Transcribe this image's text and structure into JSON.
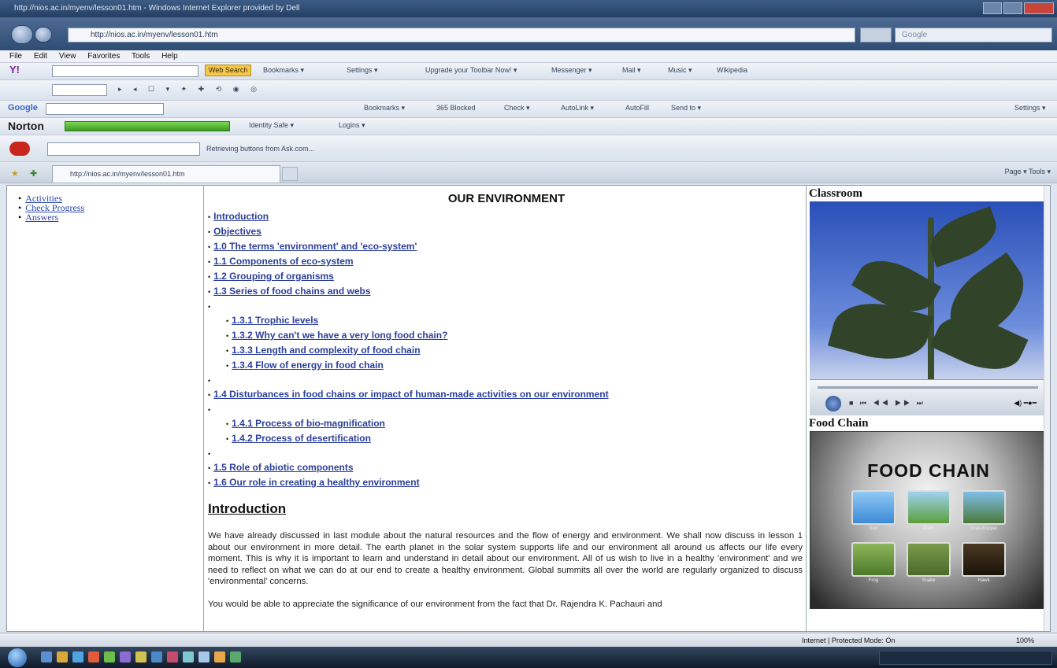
{
  "browser": {
    "title": "http://nios.ac.in/myenv/lesson01.htm - Windows Internet Explorer provided by Dell",
    "url": "http://nios.ac.in/myenv/lesson01.htm",
    "search_placeholder": "Google",
    "menu": [
      "File",
      "Edit",
      "View",
      "Favorites",
      "Tools",
      "Help"
    ],
    "tab_title": "http://nios.ac.in/myenv/lesson01.htm",
    "command_bar": "Page ▾   Tools ▾"
  },
  "toolbars": {
    "yahoo": {
      "web_search": "Web Search",
      "items": [
        "Bookmarks ▾",
        "Settings ▾",
        "Upgrade your Toolbar Now! ▾",
        "Messenger ▾",
        "Mail ▾",
        "Music ▾",
        "Wikipedia"
      ]
    },
    "google": {
      "logo": "Google",
      "items": [
        "Bookmarks ▾",
        "365 Blocked",
        "Check ▾",
        "AutoLink ▾",
        "AutoFill",
        "Send to ▾"
      ],
      "settings": "Settings ▾"
    },
    "norton": {
      "logo": "Norton",
      "items": [
        "Identity Safe ▾",
        "Logins ▾"
      ]
    },
    "ask": {
      "status": "Retrieving buttons from Ask.com..."
    }
  },
  "sidebar_left": {
    "links": [
      "Activities",
      "Check Progress",
      "Answers"
    ]
  },
  "main": {
    "title": "OUR ENVIRONMENT",
    "toc": [
      {
        "label": "Introduction",
        "level": 0
      },
      {
        "label": "Objectives",
        "level": 0
      },
      {
        "label": "1.0 The terms 'environment' and 'eco-system'",
        "level": 0
      },
      {
        "label": "1.1 Components of eco-system",
        "level": 0
      },
      {
        "label": "1.2 Grouping of organisms",
        "level": 0
      },
      {
        "label": "1.3 Series of food chains and webs",
        "level": 0
      },
      {
        "label": "1.3.1 Trophic levels",
        "level": 1
      },
      {
        "label": "1.3.2 Why can't we have a very long food chain?",
        "level": 1
      },
      {
        "label": "1.3.3 Length and complexity of food chain",
        "level": 1
      },
      {
        "label": "1.3.4 Flow of energy in food chain",
        "level": 1
      },
      {
        "label": "1.4 Disturbances in food chains or impact of human-made activities on our environment",
        "level": 0
      },
      {
        "label": "1.4.1 Process of bio-magnification",
        "level": 1
      },
      {
        "label": "1.4.2 Process of desertification",
        "level": 1
      },
      {
        "label": "1.5 Role of abiotic components",
        "level": 0
      },
      {
        "label": "1.6 Our role in creating a healthy environment",
        "level": 0
      }
    ],
    "section_heading": "Introduction",
    "paragraph_1": "We have already discussed in last module about the natural resources and the flow of energy and environment. We shall now discuss in lesson 1 about our environment in more detail. The earth planet in the solar system supports life and our environment all around us affects our life every moment. This is why it is important to learn and understand in detail about our environment. All of us wish to live in a healthy 'environment' and we need to reflect on what we can do at our end to create a healthy environment. Global summits all over the world are regularly organized to discuss 'environmental' concerns.",
    "paragraph_2": "You would be able to appreciate the significance of our environment from the fact that Dr. Rajendra K. Pachauri and"
  },
  "sidebar_right": {
    "video1_heading": "Classroom",
    "video2_heading": "Food Chain",
    "video2_title": "FOOD CHAIN",
    "video2_cards": [
      "Sun",
      "Plant",
      "Grasshopper",
      "Frog",
      "Snake",
      "Hawk"
    ]
  },
  "status": {
    "zone": "Internet | Protected Mode: On",
    "zoom": "100%"
  }
}
